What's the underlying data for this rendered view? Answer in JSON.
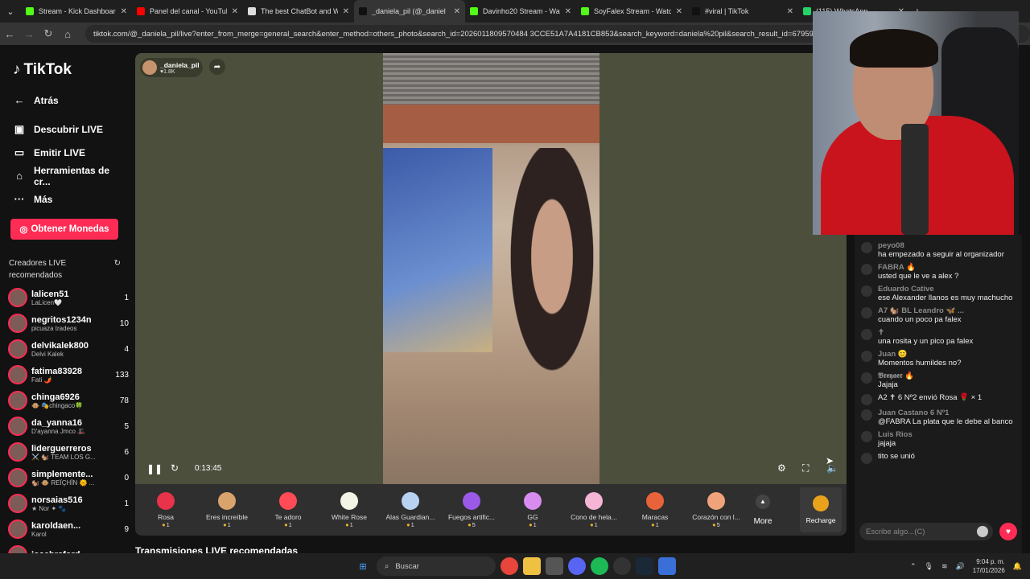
{
  "browser": {
    "tabs": [
      {
        "title": "Stream - Kick Dashboard",
        "color": "#53fc18"
      },
      {
        "title": "Panel del canal - YouTube",
        "color": "#ff0000"
      },
      {
        "title": "The best ChatBot and Wi",
        "color": "#dddddd"
      },
      {
        "title": "_daniela_pil (@_daniel",
        "color": "#111111",
        "active": true
      },
      {
        "title": "Davinho20 Stream - Watc",
        "color": "#53fc18"
      },
      {
        "title": "SoyFalex Stream - Watch",
        "color": "#53fc18"
      },
      {
        "title": "#viral | TikTok",
        "color": "#111111"
      },
      {
        "title": "(115) WhatsApp",
        "color": "#25d366"
      }
    ],
    "url": "tiktok.com/@_daniela_pil/live?enter_from_merge=general_search&enter_method=others_photo&search_id=2026011809570484 3CCE51A7A4181CB853&search_keyword=daniela%20pil&search_result_id=6795911568"
  },
  "sidebar": {
    "logo": "TikTok",
    "back": "Atrás",
    "nav": [
      {
        "icon": "live-discover-icon",
        "glyph": "▣",
        "label": "Descubrir LIVE"
      },
      {
        "icon": "video-camera-icon",
        "glyph": "▭",
        "label": "Emitir LIVE"
      },
      {
        "icon": "home-icon",
        "glyph": "⌂",
        "label": "Herramientas de cr..."
      },
      {
        "icon": "more-dots-icon",
        "glyph": "···",
        "label": "Más"
      }
    ],
    "coins_button": "Obtener Monedas",
    "rec_title": "Creadores LIVE recomendados",
    "creators": [
      {
        "name": "lalicen51",
        "sub": "LaLicen🤍",
        "count": "1"
      },
      {
        "name": "negritos1234n",
        "sub": "picuaza tradeos",
        "count": "10"
      },
      {
        "name": "delvikalek800",
        "sub": "Delvi Kalek",
        "count": "4"
      },
      {
        "name": "fatima83928",
        "sub": "Fati 🌶️",
        "count": "133"
      },
      {
        "name": "chinga6926",
        "sub": "🐵 🎭chingaco🍀",
        "count": "78"
      },
      {
        "name": "da_yanna16",
        "sub": "D'ayanna Jmco 🎩",
        "count": "5"
      },
      {
        "name": "liderguerreros",
        "sub": "⚔️ 🐿️ TEAM LOS G...",
        "count": "6"
      },
      {
        "name": "simplemente...",
        "sub": "🐿️ 🐵 REÏÇHÏN 🌞 ...",
        "count": "0"
      },
      {
        "name": "norsaias516",
        "sub": "★ Nor ✦ 🐾",
        "count": "1"
      },
      {
        "name": "karoldaen...",
        "sub": "Karol",
        "count": "9"
      },
      {
        "name": "josebraford",
        "sub": "",
        "count": ""
      }
    ]
  },
  "player": {
    "host": "_daniela_pil",
    "likes": "♥1.8K",
    "time": "0:13:45"
  },
  "gifts": [
    {
      "name": "Rosa",
      "cost": "1",
      "color": "#e8334a"
    },
    {
      "name": "Eres increíble",
      "cost": "1",
      "color": "#d8a36c"
    },
    {
      "name": "Te adoro",
      "cost": "1",
      "color": "#ff4b55"
    },
    {
      "name": "White Rose",
      "cost": "1",
      "color": "#f3f3e6"
    },
    {
      "name": "Alas Guardian...",
      "cost": "1",
      "color": "#b8d3f2"
    },
    {
      "name": "Fuegos artific...",
      "cost": "5",
      "color": "#9b59e8"
    },
    {
      "name": "GG",
      "cost": "1",
      "color": "#d98cf0"
    },
    {
      "name": "Cono de hela...",
      "cost": "1",
      "color": "#f5b5d5"
    },
    {
      "name": "Maracas",
      "cost": "1",
      "color": "#e8633a"
    },
    {
      "name": "Corazón con l...",
      "cost": "5",
      "color": "#f0a37a"
    }
  ],
  "more_label": "More",
  "recharge_label": "Recharge",
  "recommended_title": "Transmisiones LIVE recomendadas",
  "chat": {
    "messages": [
      {
        "user": "peyo08",
        "text": "ha empezado a seguir al organizador"
      },
      {
        "user": "FABRA 🔥",
        "text": "usted que le ve a alex ?"
      },
      {
        "user": "Eduardo Cative",
        "text": "ese Alexander llanos es muy machucho"
      },
      {
        "user": "A7 🐿️ BL Leandro 🦋 ...",
        "text": "cuando un poco pa falex"
      },
      {
        "user": "✝",
        "text": "una rosita y un pico pa falex"
      },
      {
        "user": "Juan 😊",
        "text": "Momentos humildes no?"
      },
      {
        "user": "𝕭𝖗𝖊𝖞𝖆𝖊𝖗 🔥",
        "text": "Jajaja"
      },
      {
        "user": "",
        "text": "A2 ✝ 6 Nº2 envió Rosa 🌹 × 1"
      },
      {
        "user": "Juan Castano 6 Nº1",
        "text": "@FABRA La plata que le debe al banco"
      },
      {
        "user": "Luis Rios",
        "text": "jajaja"
      },
      {
        "user": "",
        "text": "tito se unió"
      }
    ],
    "input_placeholder": "Escribe algo...(C)"
  },
  "taskbar": {
    "search": "Buscar",
    "time": "9:04 p. m.",
    "date": "17/01/2026"
  }
}
